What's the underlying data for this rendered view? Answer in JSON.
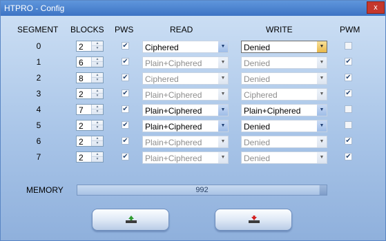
{
  "window": {
    "title": "HTPRO - Config",
    "close_label": "x"
  },
  "headers": {
    "segment": "SEGMENT",
    "blocks": "BLOCKS",
    "pws": "PWS",
    "read": "READ",
    "write": "WRITE",
    "pwm": "PWM"
  },
  "rows": [
    {
      "segment": "0",
      "blocks": "2",
      "pws": true,
      "read": "Ciphered",
      "write": "Denied",
      "pwm": false,
      "enabled": true
    },
    {
      "segment": "1",
      "blocks": "6",
      "pws": true,
      "read": "Plain+Ciphered",
      "write": "Denied",
      "pwm": true,
      "enabled": false
    },
    {
      "segment": "2",
      "blocks": "8",
      "pws": true,
      "read": "Ciphered",
      "write": "Denied",
      "pwm": true,
      "enabled": false
    },
    {
      "segment": "3",
      "blocks": "2",
      "pws": true,
      "read": "Plain+Ciphered",
      "write": "Ciphered",
      "pwm": true,
      "enabled": false
    },
    {
      "segment": "4",
      "blocks": "7",
      "pws": true,
      "read": "Plain+Ciphered",
      "write": "Plain+Ciphered",
      "pwm": false,
      "enabled": true
    },
    {
      "segment": "5",
      "blocks": "2",
      "pws": true,
      "read": "Plain+Ciphered",
      "write": "Denied",
      "pwm": false,
      "enabled": true
    },
    {
      "segment": "6",
      "blocks": "2",
      "pws": true,
      "read": "Plain+Ciphered",
      "write": "Denied",
      "pwm": true,
      "enabled": false
    },
    {
      "segment": "7",
      "blocks": "2",
      "pws": true,
      "read": "Plain+Ciphered",
      "write": "Denied",
      "pwm": true,
      "enabled": false
    }
  ],
  "memory": {
    "label": "MEMORY",
    "value": "992",
    "fill_fraction": 0.97
  },
  "buttons": [
    {
      "name": "upload-button",
      "icon": "upload-arrow-icon",
      "icon_color": "#2e9a2e"
    },
    {
      "name": "download-button",
      "icon": "download-arrow-icon",
      "icon_color": "#d32020"
    }
  ]
}
